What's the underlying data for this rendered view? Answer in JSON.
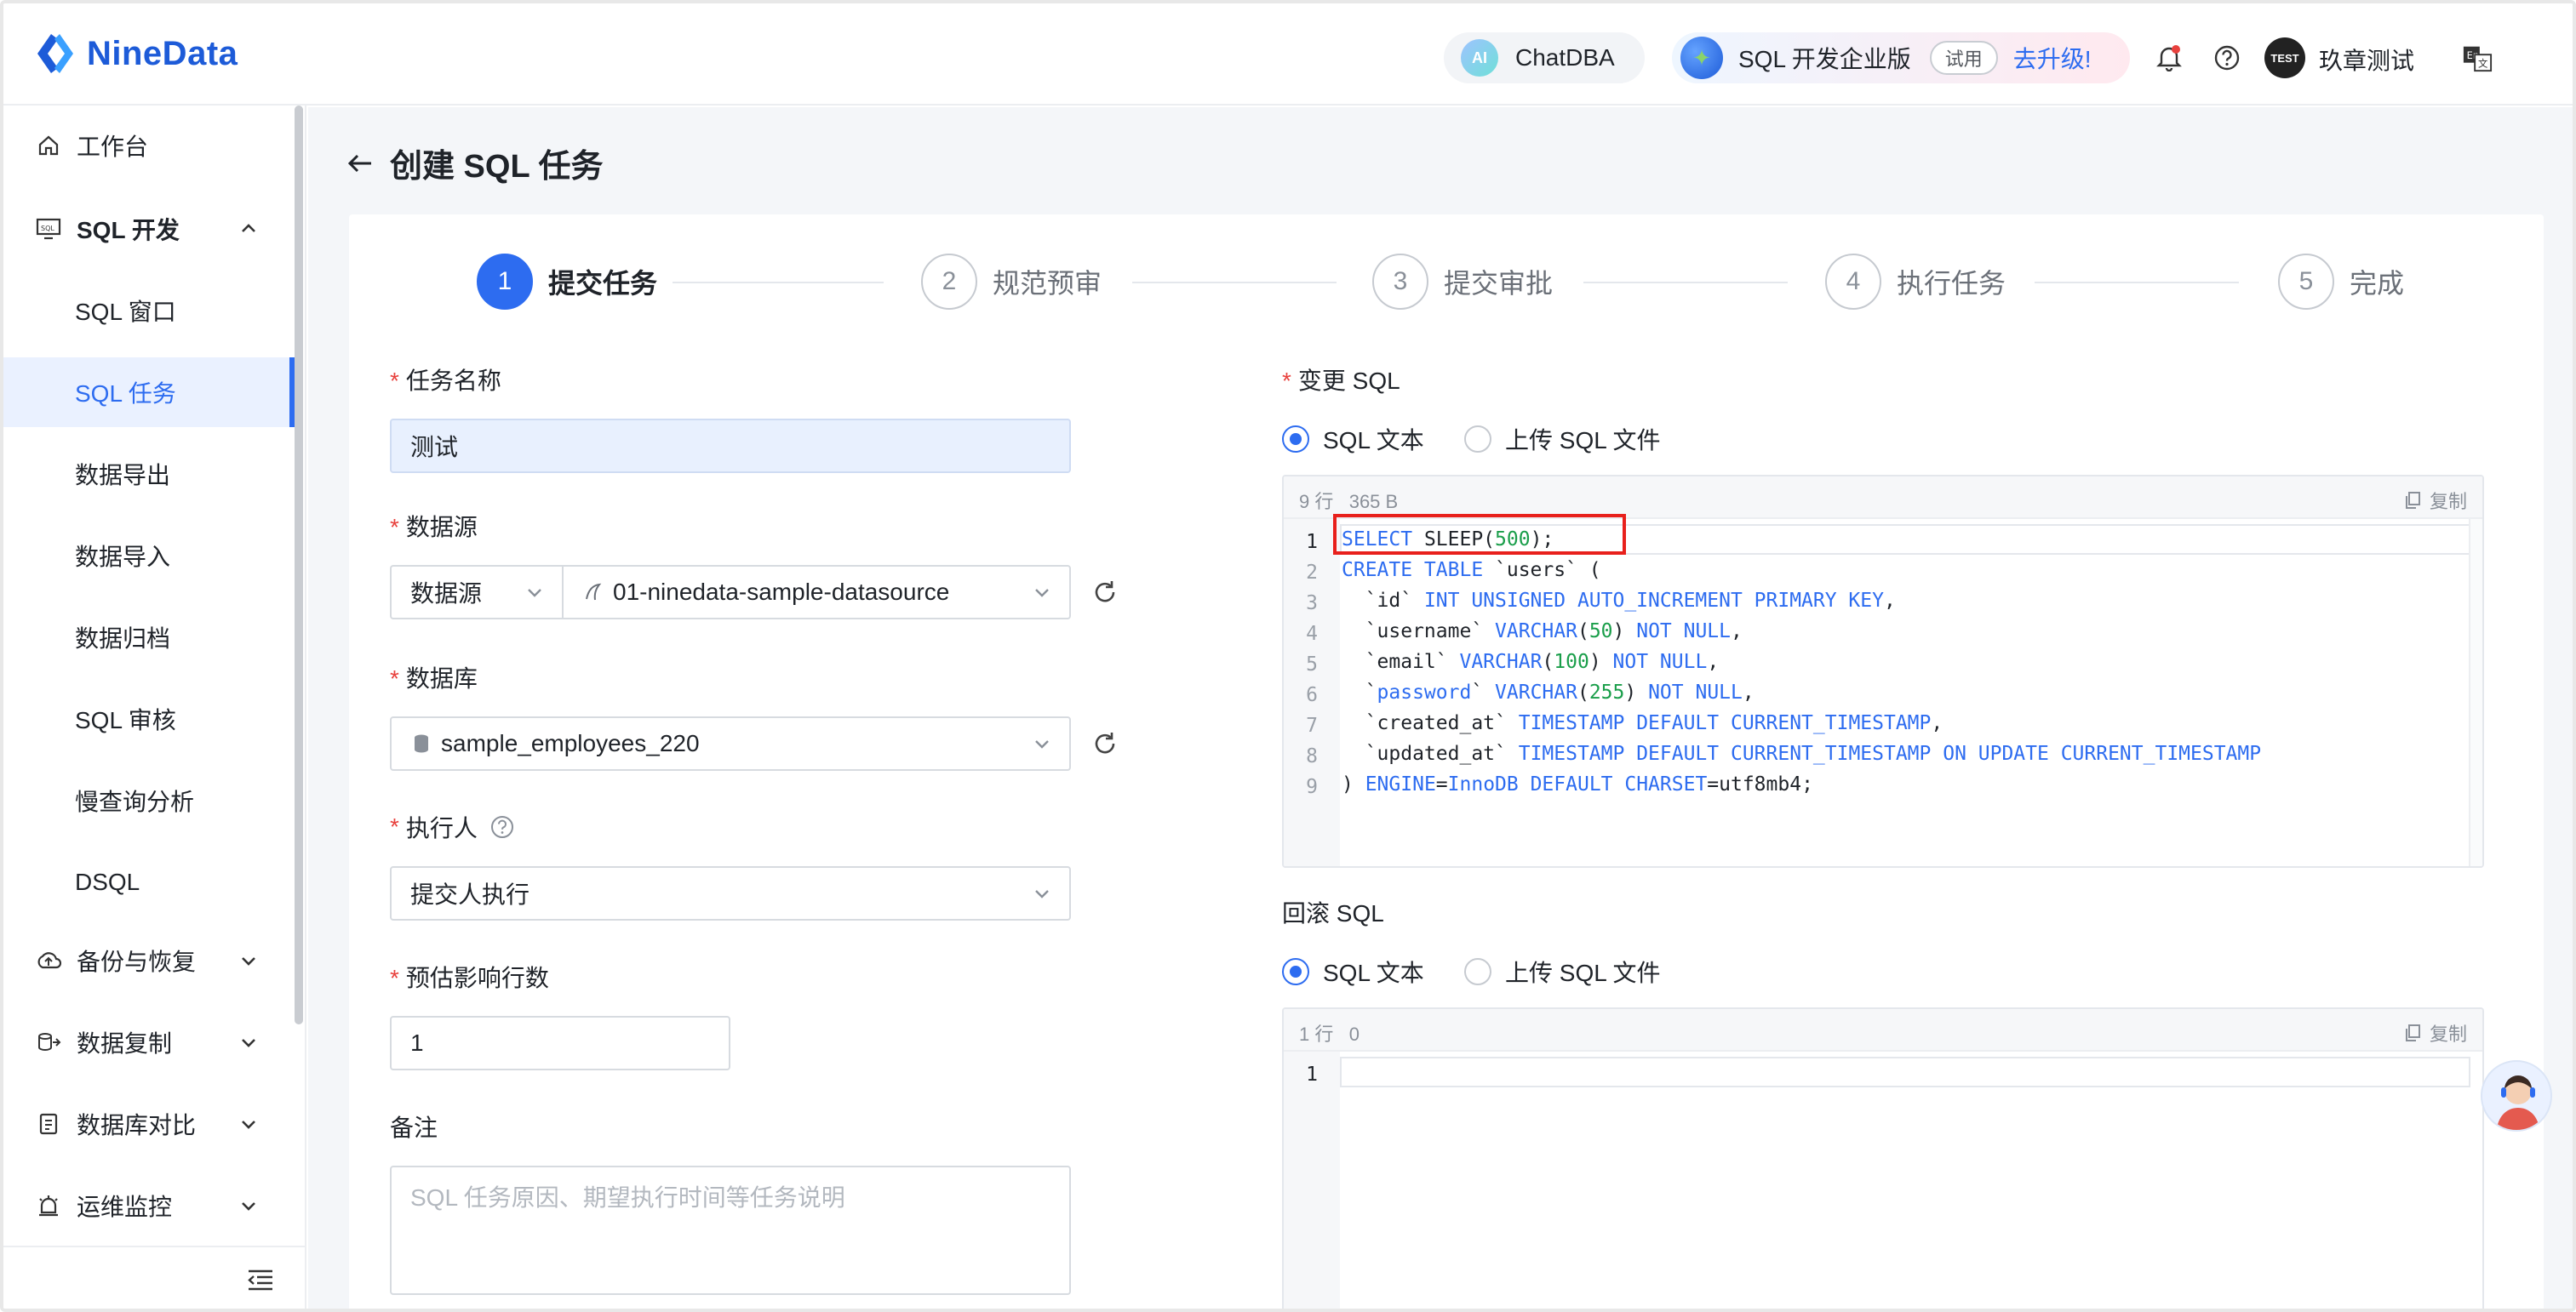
{
  "header": {
    "logo_text": "NineData",
    "chatdba_label": "ChatDBA",
    "ai_badge": "AI",
    "edition_label": "SQL 开发企业版",
    "trial_label": "试用",
    "upgrade_label": "去升级!",
    "avatar_text": "TEST",
    "user_name": "玖章测试",
    "icons": [
      "bell-icon",
      "help-icon",
      "language-icon"
    ]
  },
  "sidebar": {
    "items": [
      {
        "label": "工作台",
        "icon": "home-icon"
      },
      {
        "label": "SQL 开发",
        "icon": "sql-dev-icon"
      },
      {
        "label": "SQL 窗口"
      },
      {
        "label": "SQL 任务"
      },
      {
        "label": "数据导出"
      },
      {
        "label": "数据导入"
      },
      {
        "label": "数据归档"
      },
      {
        "label": "SQL 审核"
      },
      {
        "label": "慢查询分析"
      },
      {
        "label": "DSQL"
      },
      {
        "label": "备份与恢复",
        "icon": "backup-icon"
      },
      {
        "label": "数据复制",
        "icon": "replication-icon"
      },
      {
        "label": "数据库对比",
        "icon": "compare-icon"
      },
      {
        "label": "运维监控",
        "icon": "monitor-icon"
      }
    ],
    "active_item": "SQL 任务"
  },
  "page": {
    "title": "创建 SQL 任务"
  },
  "steps": [
    {
      "num": "1",
      "label": "提交任务"
    },
    {
      "num": "2",
      "label": "规范预审"
    },
    {
      "num": "3",
      "label": "提交审批"
    },
    {
      "num": "4",
      "label": "执行任务"
    },
    {
      "num": "5",
      "label": "完成"
    }
  ],
  "current_step": 1,
  "form": {
    "task_name_label": "任务名称",
    "task_name_value": "测试",
    "datasource_label": "数据源",
    "datasource_type": "数据源",
    "datasource_value": "01-ninedata-sample-datasource",
    "database_label": "数据库",
    "database_value": "sample_employees_220",
    "executor_label": "执行人",
    "executor_value": "提交人执行",
    "affected_rows_label": "预估影响行数",
    "affected_rows_value": "1",
    "remark_label": "备注",
    "remark_placeholder": "SQL 任务原因、期望执行时间等任务说明"
  },
  "change_sql": {
    "label": "变更 SQL",
    "option_text": "SQL 文本",
    "option_file": "上传 SQL 文件",
    "selected": "SQL 文本",
    "lines_count": "9 行",
    "size": "365 B",
    "copy_label": "复制",
    "line_numbers": [
      "1",
      "2",
      "3",
      "4",
      "5",
      "6",
      "7",
      "8",
      "9"
    ]
  },
  "rollback_sql": {
    "label": "回滚 SQL",
    "option_text": "SQL 文本",
    "option_file": "上传 SQL 文件",
    "selected": "SQL 文本",
    "lines_count": "1 行",
    "size": "0",
    "copy_label": "复制",
    "line_numbers": [
      "1"
    ]
  },
  "colors": {
    "primary": "#2d6cf0",
    "required": "#e8413d",
    "highlight_box": "#e8201c",
    "number_literal": "#1a9e4a"
  }
}
